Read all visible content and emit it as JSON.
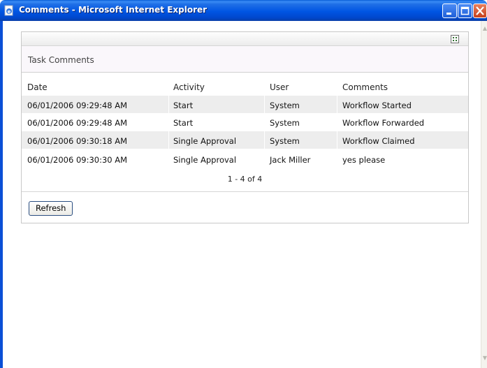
{
  "window": {
    "title": "Comments - Microsoft Internet Explorer",
    "app_icon": "ie-page-icon",
    "controls": [
      "minimize-icon",
      "maximize-icon",
      "close-icon"
    ]
  },
  "panel": {
    "title": "Task Comments",
    "toolbar_icon": "grid-view-icon",
    "table": {
      "columns": [
        "Date",
        "Activity",
        "User",
        "Comments"
      ],
      "rows": [
        [
          "06/01/2006 09:29:48 AM",
          "Start",
          "System",
          "Workflow Started"
        ],
        [
          "06/01/2006 09:29:48 AM",
          "Start",
          "System",
          "Workflow Forwarded"
        ],
        [
          "06/01/2006 09:30:18 AM",
          "Single Approval",
          "System",
          "Workflow Claimed"
        ],
        [
          "06/01/2006 09:30:30 AM",
          "Single Approval",
          "Jack Miller",
          "yes please"
        ]
      ]
    },
    "pager": "1 - 4 of 4",
    "refresh_label": "Refresh"
  },
  "colors": {
    "titlebar": "#0055e3",
    "row_shade": "#ededed",
    "header_band": "#faf7fb",
    "close_button": "#c6401c"
  }
}
